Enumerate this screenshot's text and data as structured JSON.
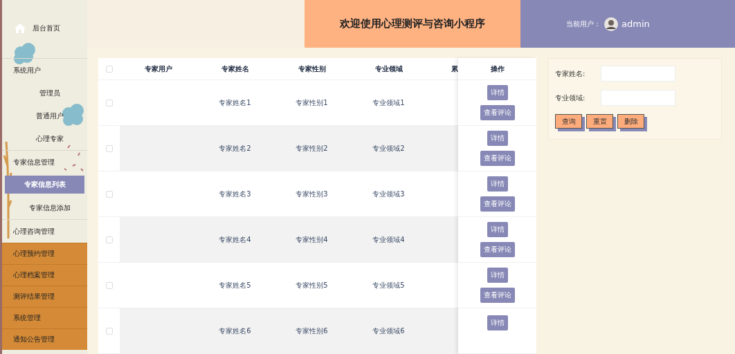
{
  "sidebar": {
    "items": [
      {
        "label": "后台首页",
        "kind": "home",
        "selected": false
      },
      {
        "label": "系统用户",
        "kind": "group",
        "selected": false,
        "children": [
          {
            "label": "管理员",
            "selected": false
          },
          {
            "label": "普通用户",
            "selected": false
          },
          {
            "label": "心理专家",
            "selected": false
          }
        ]
      },
      {
        "label": "专家信息管理",
        "kind": "group",
        "selected": false,
        "children": [
          {
            "label": "专家信息列表",
            "selected": true
          },
          {
            "label": "专家信息添加",
            "selected": false
          }
        ]
      },
      {
        "label": "心理咨询管理",
        "kind": "group",
        "selected": false
      },
      {
        "label": "心理预约管理",
        "kind": "menu",
        "selected": false
      },
      {
        "label": "心理档案管理",
        "kind": "menu",
        "selected": false
      },
      {
        "label": "测评结果管理",
        "kind": "menu",
        "selected": false
      },
      {
        "label": "系统管理",
        "kind": "menu",
        "selected": false
      },
      {
        "label": "通知公告管理",
        "kind": "menu",
        "selected": false
      }
    ]
  },
  "header": {
    "title": "欢迎使用心理测评与咨询小程序",
    "user_label": "当前用户：",
    "username": "admin"
  },
  "table": {
    "all_checked": false,
    "columns": [
      "专家用户",
      "专家姓名",
      "专家性别",
      "专业领域",
      "累"
    ],
    "action_column": "操作",
    "rows": [
      {
        "checked": false,
        "cells": [
          "",
          "专家姓名1",
          "专家性别1",
          "专业领域1",
          ""
        ],
        "actions": [
          "详情",
          "查看评论"
        ]
      },
      {
        "checked": false,
        "cells": [
          "",
          "专家姓名2",
          "专家性别2",
          "专业领域2",
          ""
        ],
        "actions": [
          "详情",
          "查看评论"
        ]
      },
      {
        "checked": false,
        "cells": [
          "",
          "专家姓名3",
          "专家性别3",
          "专业领域3",
          ""
        ],
        "actions": [
          "详情",
          "查看评论"
        ]
      },
      {
        "checked": false,
        "cells": [
          "",
          "专家姓名4",
          "专家性别4",
          "专业领域4",
          ""
        ],
        "actions": [
          "详情",
          "查看评论"
        ]
      },
      {
        "checked": false,
        "cells": [
          "",
          "专家姓名5",
          "专家性别5",
          "专业领域5",
          ""
        ],
        "actions": [
          "详情",
          "查看评论"
        ]
      },
      {
        "checked": false,
        "cells": [
          "",
          "专家姓名6",
          "专家性别6",
          "专业领域6",
          ""
        ],
        "actions": [
          "详情"
        ]
      }
    ]
  },
  "search": {
    "fields": [
      {
        "label": "专家姓名:"
      },
      {
        "label": "专业领域:"
      }
    ],
    "buttons": [
      "查询",
      "重置",
      "删除"
    ]
  }
}
